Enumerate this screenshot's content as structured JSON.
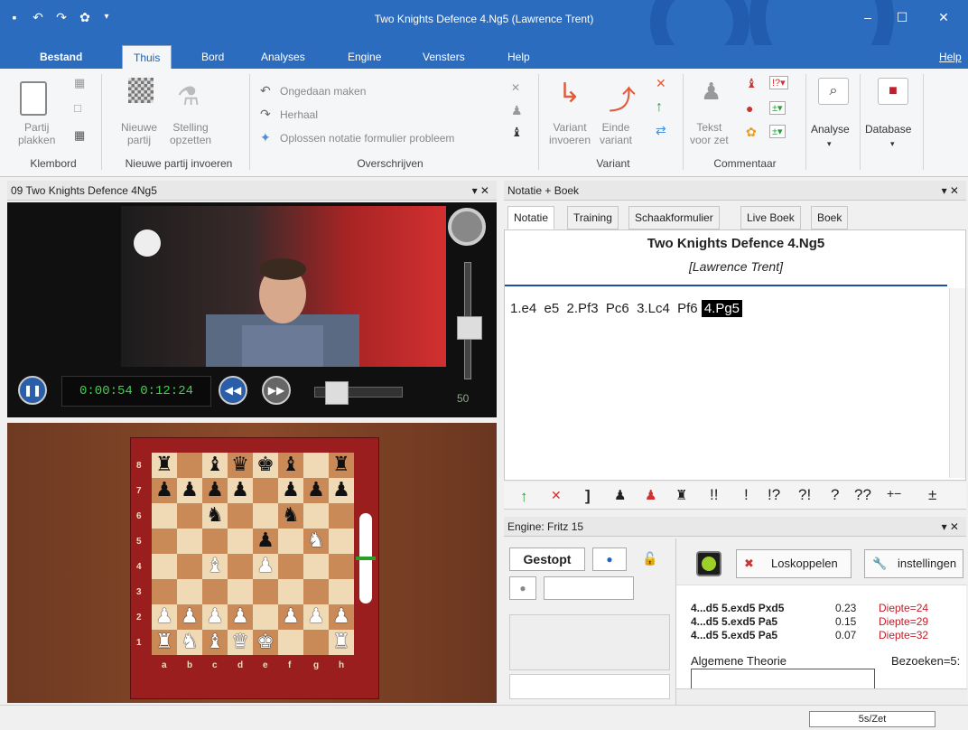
{
  "window": {
    "title": "Two Knights Defence 4.Ng5  (Lawrence Trent)"
  },
  "menu": {
    "items": [
      "Bestand",
      "Thuis",
      "Bord",
      "Analyses",
      "Engine",
      "Vensters",
      "Help"
    ],
    "help_right": "Help"
  },
  "ribbon": {
    "partij_plakken": "Partij\nplakken",
    "nieuwe_partij": "Nieuwe\npartij",
    "stelling_opzetten": "Stelling\nopzetten",
    "undo": "Ongedaan maken",
    "redo": "Herhaal",
    "solve": "Oplossen notatie formulier probleem",
    "variant_invoeren": "Variant\ninvoeren",
    "einde_variant": "Einde\nvariant",
    "tekst_voor_zet": "Tekst\nvoor zet",
    "analyse": "Analyse",
    "database": "Database",
    "groups": [
      "Klembord",
      "Nieuwe partij invoeren",
      "Overschrijven",
      "Variant",
      "Commentaar"
    ]
  },
  "video_panel": {
    "title": "09 Two Knights Defence 4Ng5",
    "time": "0:00:54 0:12:24",
    "volume": "50"
  },
  "notation_panel": {
    "title": "Notatie + Boek",
    "tabs": [
      "Notatie",
      "Training",
      "Schaakformulier",
      "Live Boek",
      "Boek"
    ],
    "game_title": "Two Knights Defence 4.Ng5",
    "players": "[Lawrence Trent]",
    "moves": "1.e4  e5  2.Pf3  Pc6  3.Lc4  Pf6",
    "current_move": "4.Pg5",
    "annotations": [
      "!!",
      "!",
      "!?",
      "?!",
      "?",
      "??",
      "+−",
      "±"
    ]
  },
  "engine_panel": {
    "title": "Engine: Fritz 15",
    "status": "Gestopt",
    "disconnect": "Loskoppelen",
    "settings": "instellingen",
    "lines": [
      {
        "line": "4...d5 5.exd5 Pxd5",
        "eval": "0.23",
        "depth": "Diepte=24"
      },
      {
        "line": "4...d5 5.exd5 Pa5",
        "eval": "0.15",
        "depth": "Diepte=29"
      },
      {
        "line": "4...d5 5.exd5 Pa5",
        "eval": "0.07",
        "depth": "Diepte=32"
      }
    ],
    "book_label": "Algemene Theorie",
    "visits": "Bezoeken=5:"
  },
  "board": {
    "rows": [
      [
        "bR",
        "",
        "bB",
        "bQ",
        "bK",
        "bB",
        "",
        "bR"
      ],
      [
        "bP",
        "bP",
        "bP",
        "bP",
        "",
        "bP",
        "bP",
        "bP"
      ],
      [
        "",
        "",
        "bN",
        "",
        "",
        "bN",
        "",
        ""
      ],
      [
        "",
        "",
        "",
        "",
        "bP",
        "",
        "wN",
        ""
      ],
      [
        "",
        "",
        "wB",
        "",
        "wP",
        "",
        "",
        ""
      ],
      [
        "",
        "",
        "",
        "",
        "",
        "",
        "",
        ""
      ],
      [
        "wP",
        "wP",
        "wP",
        "wP",
        "",
        "wP",
        "wP",
        "wP"
      ],
      [
        "wR",
        "wN",
        "wB",
        "wQ",
        "wK",
        "",
        "",
        "wR"
      ]
    ],
    "ranks": [
      "8",
      "7",
      "6",
      "5",
      "4",
      "3",
      "2",
      "1"
    ],
    "files": [
      "a",
      "b",
      "c",
      "d",
      "e",
      "f",
      "g",
      "h"
    ]
  },
  "status": {
    "time_control": "5s/Zet"
  }
}
